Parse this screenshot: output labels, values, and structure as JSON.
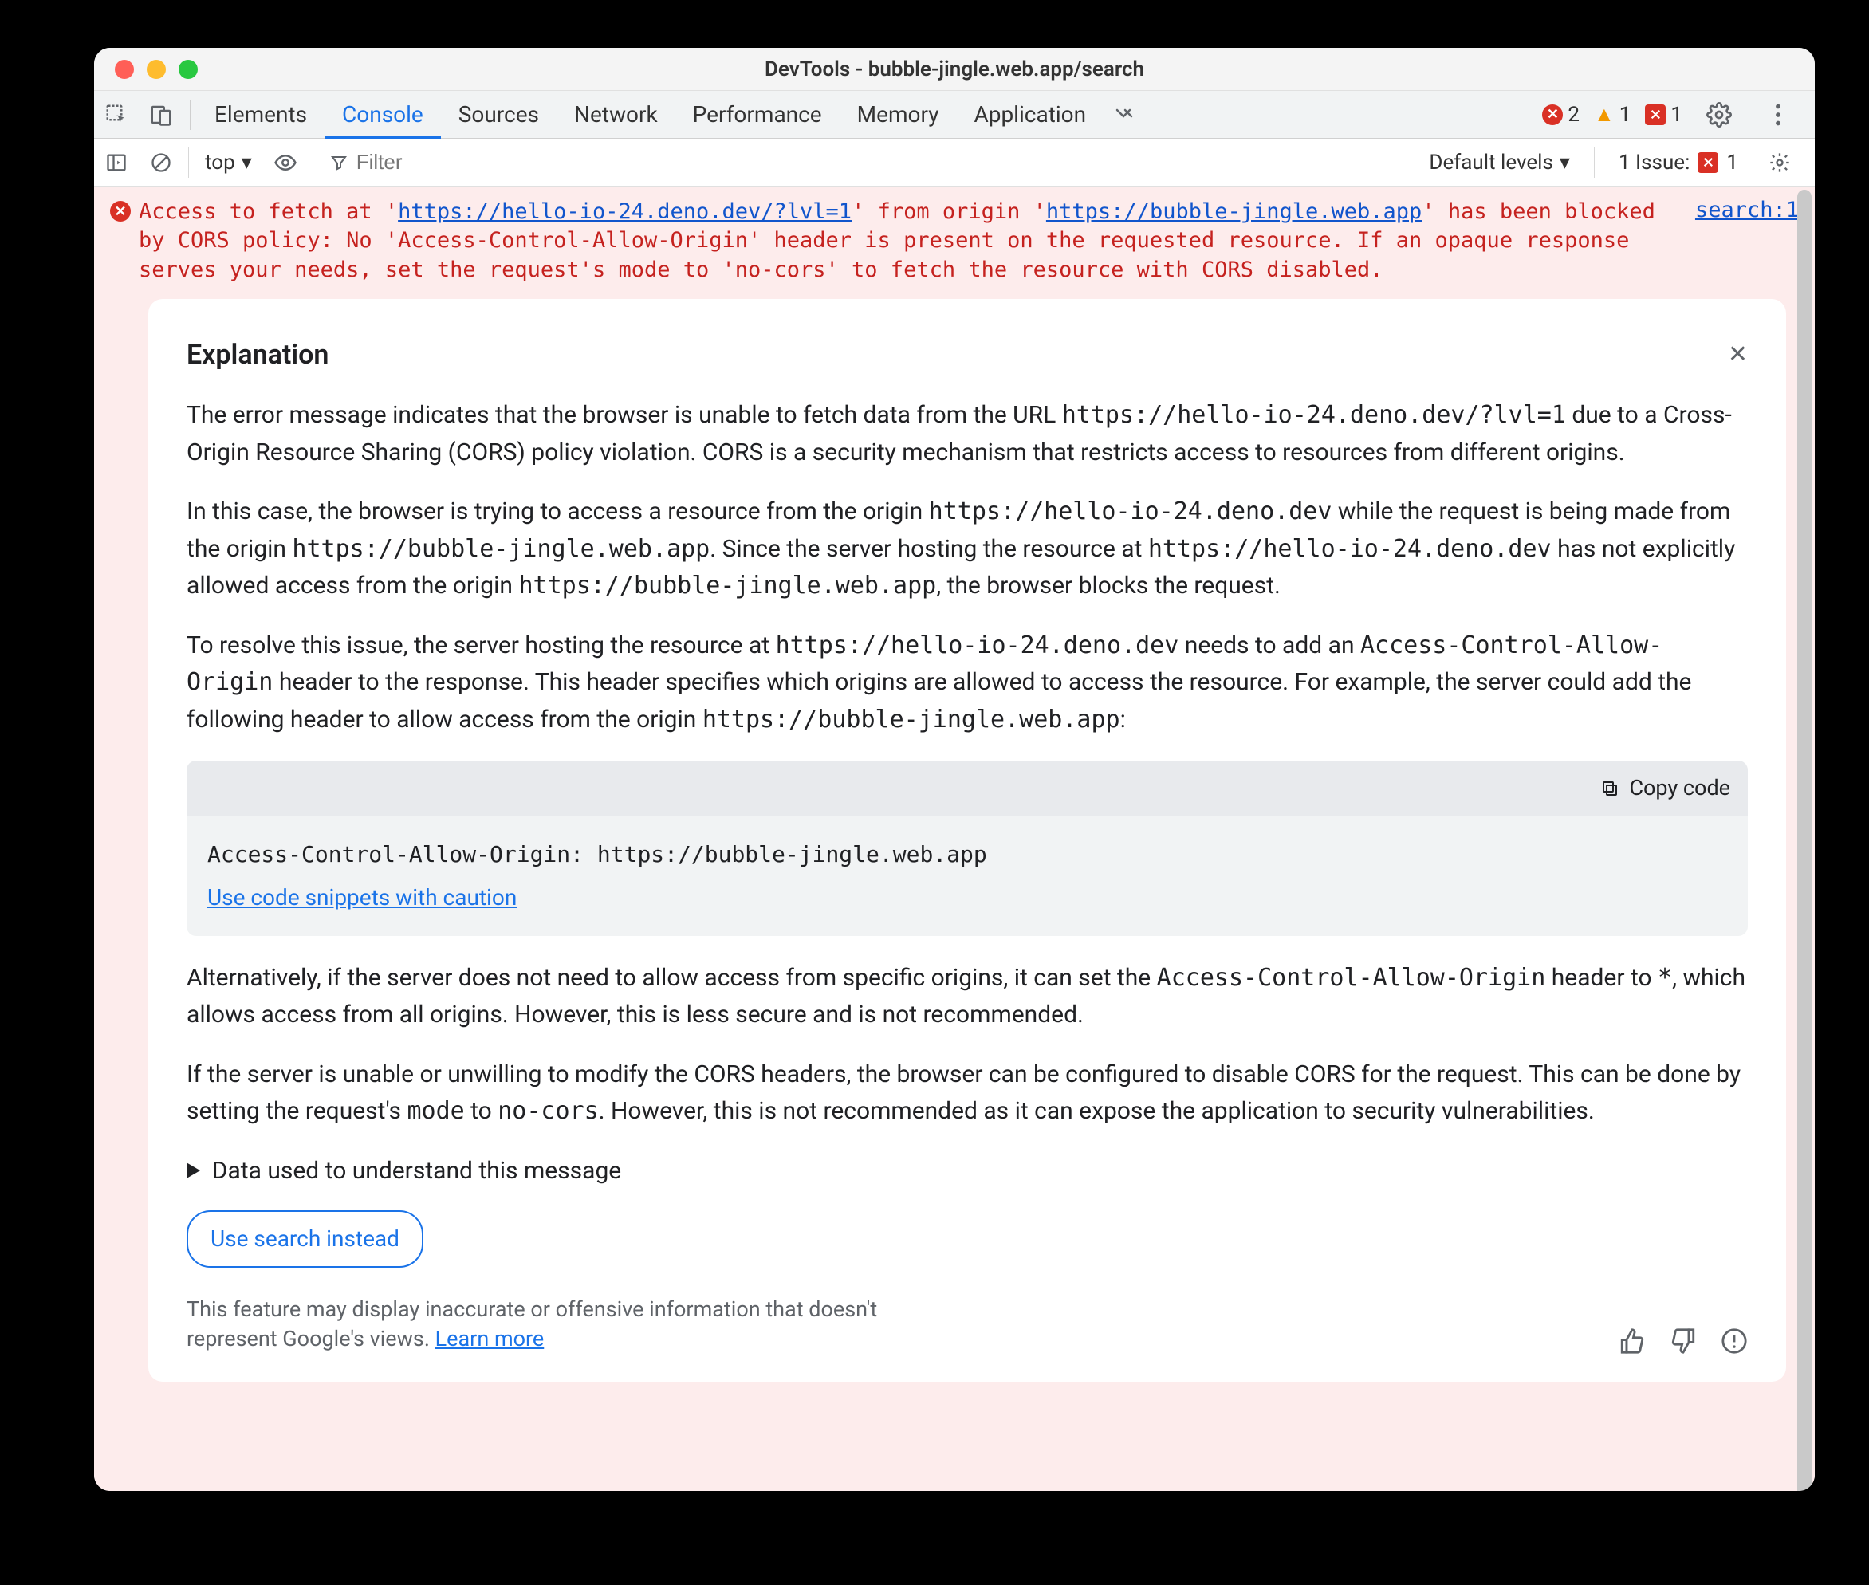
{
  "window": {
    "title": "DevTools - bubble-jingle.web.app/search"
  },
  "tabs": [
    "Elements",
    "Console",
    "Sources",
    "Network",
    "Performance",
    "Memory",
    "Application"
  ],
  "counters": {
    "errors": "2",
    "warnings": "1",
    "issues": "1"
  },
  "console": {
    "context": "top",
    "filter_placeholder": "Filter",
    "default_levels": "Default levels",
    "issues_label": "1 Issue:",
    "issues_count": "1"
  },
  "error": {
    "msg_parts": [
      "Access to fetch at '",
      "https://hello-io-24.deno.dev/?lvl=1",
      "' from origin '",
      "https://bubble-jingle.web.app",
      "' has been blocked by CORS policy: No 'Access-Control-Allow-Origin' header is present on the requested resource. If an opaque response serves your needs, set the request's mode to 'no-cors' to fetch the resource with CORS disabled."
    ],
    "source": "search:1"
  },
  "explanation": {
    "title": "Explanation",
    "p1": [
      "The error message indicates that the browser is unable to fetch data from the URL ",
      "https://hello-io-24.deno.dev/?lvl=1",
      " due to a Cross-Origin Resource Sharing (CORS) policy violation. CORS is a security mechanism that restricts access to resources from different origins."
    ],
    "p2": [
      "In this case, the browser is trying to access a resource from the origin ",
      "https://hello-io-24.deno.dev",
      " while the request is being made from the origin ",
      "https://bubble-jingle.web.app",
      ". Since the server hosting the resource at ",
      "https://hello-io-24.deno.dev",
      " has not explicitly allowed access from the origin ",
      "https://bubble-jingle.web.app",
      ", the browser blocks the request."
    ],
    "p3": [
      "To resolve this issue, the server hosting the resource at ",
      "https://hello-io-24.deno.dev",
      " needs to add an ",
      "Access-Control-Allow-Origin",
      " header to the response. This header specifies which origins are allowed to access the resource. For example, the server could add the following header to allow access from the origin ",
      "https://bubble-jingle.web.app",
      ":"
    ],
    "copy_code": "Copy code",
    "code": "Access-Control-Allow-Origin: https://bubble-jingle.web.app",
    "caution_link": "Use code snippets with caution",
    "p4": [
      "Alternatively, if the server does not need to allow access from specific origins, it can set the ",
      "Access-Control-Allow-Origin",
      " header to ",
      "*",
      ", which allows access from all origins. However, this is less secure and is not recommended."
    ],
    "p5": [
      "If the server is unable or unwilling to modify the CORS headers, the browser can be configured to disable CORS for the request. This can be done by setting the request's ",
      "mode",
      " to ",
      "no-cors",
      ". However, this is not recommended as it can expose the application to security vulnerabilities."
    ],
    "details_summary": "Data used to understand this message",
    "use_search": "Use search instead",
    "disclaimer": "This feature may display inaccurate or offensive information that doesn't represent Google's views. ",
    "learn_more": "Learn more"
  }
}
